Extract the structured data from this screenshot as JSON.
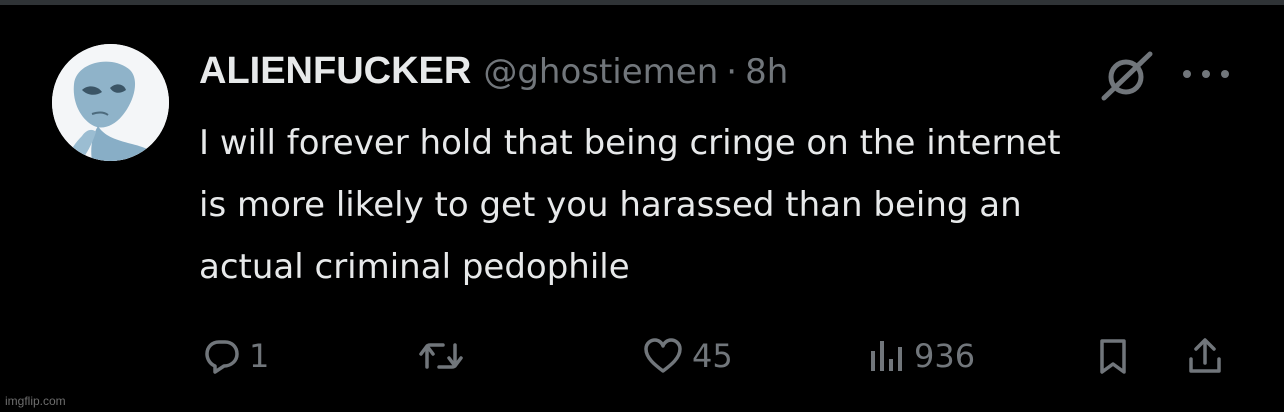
{
  "tweet": {
    "display_name": "ALIENFUCKER",
    "handle": "@ghostiemen",
    "separator": "·",
    "time": "8h",
    "text": "I will forever hold that being cringe on the internet\nis more likely to get you harassed than being an\nactual criminal pedophile"
  },
  "actions": {
    "reply_count": "1",
    "retweet_count": "",
    "like_count": "45",
    "view_count": "936"
  },
  "icons": {
    "reply": "reply-icon",
    "retweet": "retweet-icon",
    "like": "heart-icon",
    "views": "views-icon",
    "bookmark": "bookmark-icon",
    "share": "share-icon",
    "grok": "grok-icon",
    "more": "more-icon"
  },
  "colors": {
    "background": "#000000",
    "text_primary": "#e7e9ea",
    "text_secondary": "#71767b"
  },
  "watermark": "imgflip.com"
}
